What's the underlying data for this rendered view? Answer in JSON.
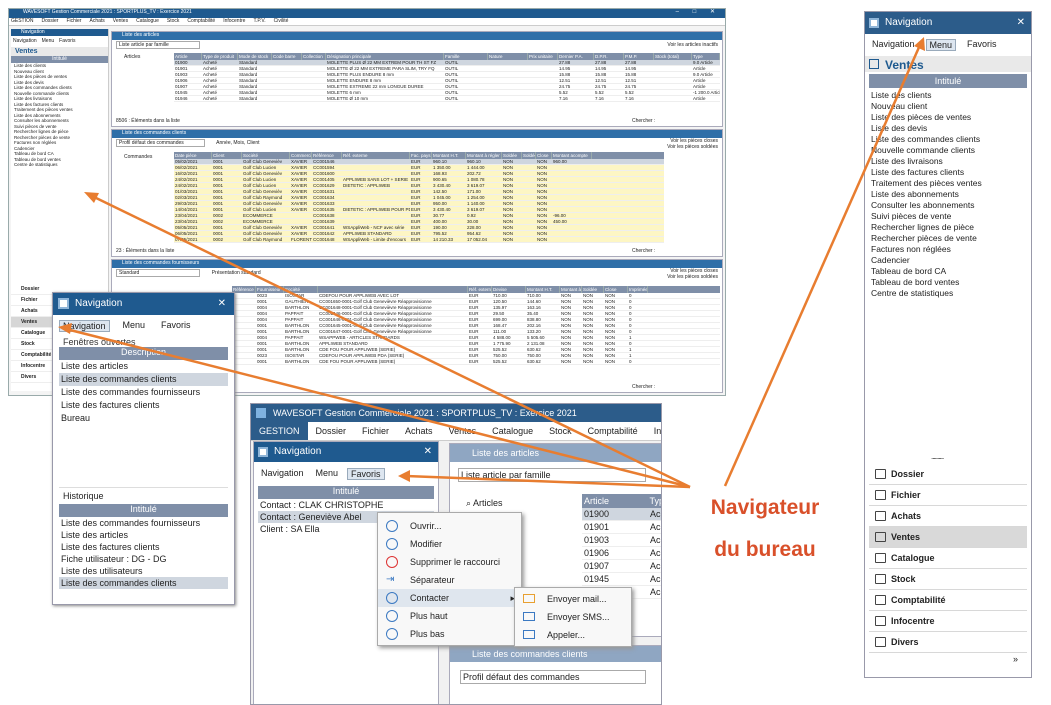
{
  "main_window": {
    "title": "WAVESOFT Gestion Commerciale 2021 : SPORTPLUS_TV : Exercice 2021",
    "menu": [
      "GESTION",
      "Dossier",
      "Fichier",
      "Achats",
      "Ventes",
      "Catalogue",
      "Stock",
      "Comptabilité",
      "Infocentre",
      "T.P.V.",
      "Civilité"
    ]
  },
  "nav_small": {
    "title": "Navigation",
    "tabs": [
      "Navigation",
      "Menu",
      "Favoris"
    ],
    "section": "Ventes",
    "col": "Intitulé",
    "items": [
      "Liste des clients",
      "Nouveau client",
      "Liste des pièces de ventes",
      "Liste des devis",
      "Liste des commandes clients",
      "Nouvelle commande clients",
      "Liste des livraisons",
      "Liste des factures clients",
      "Traitement des pièces ventes",
      "Liste des abonnements",
      "Consulter les abonnements",
      "Suivi pièces de vente",
      "Rechercher lignes de pièce",
      "Rechercher pièces de vente",
      "Factures non réglées",
      "Cadencier",
      "Tableau de bord CA",
      "Tableau de bord ventes",
      "Centre de statistiques"
    ],
    "cats": [
      "Dossier",
      "Fichier",
      "Achats",
      "Ventes",
      "Catalogue",
      "Stock",
      "Comptabilité",
      "Infocentre",
      "Divers"
    ]
  },
  "articles": {
    "title": "Liste des articles",
    "filter": "Liste article par famille",
    "check": "Voir les articles inactifs",
    "tree": "Articles",
    "cols": [
      "Article",
      "Type de produit",
      "Mode de stock",
      "Code barre",
      "Collection",
      "Désignation principale",
      "Famille",
      "Nature",
      "Prix unitaire",
      "Dernier P.A.",
      "D.P.R.",
      "P.M.P.",
      "Stock (total)",
      "Type"
    ],
    "rows": [
      [
        "01900",
        "Acheté",
        "Standard",
        "",
        "",
        "MOLETTE PLUS Ø 22 MM EXTREM POUR TH ST FZ",
        "OUTIL",
        "",
        "",
        "27.88",
        "27.88",
        "27.88",
        "",
        "9.0 Article"
      ],
      [
        "01901",
        "Acheté",
        "Standard",
        "",
        "",
        "MOLETTE Ø 22 MM EXTREME PARA SLIM, TRY FQ",
        "OUTIL",
        "",
        "",
        "14.95",
        "14.95",
        "14.95",
        "",
        "Article"
      ],
      [
        "01903",
        "Acheté",
        "Standard",
        "",
        "",
        "MOLETTE PLUS ENDURE 8 mm",
        "OUTIL",
        "",
        "",
        "15.88",
        "15.88",
        "15.88",
        "",
        "9.0 Article"
      ],
      [
        "01906",
        "Acheté",
        "Standard",
        "",
        "",
        "MOLETTE ENDURE 8 mm",
        "OUTIL",
        "",
        "",
        "12.51",
        "12.51",
        "12.51",
        "",
        "Article"
      ],
      [
        "01907",
        "Acheté",
        "Standard",
        "",
        "",
        "MOLETTE EXTREME 22 mm LONGUE DUREE",
        "OUTIL",
        "",
        "",
        "24.75",
        "24.75",
        "24.75",
        "",
        "Article"
      ],
      [
        "01945",
        "Acheté",
        "Standard",
        "",
        "",
        "MOLETTE 6 mm",
        "OUTIL",
        "",
        "",
        "5.52",
        "5.52",
        "5.52",
        "",
        "-1 200.0 Article"
      ],
      [
        "01946",
        "Acheté",
        "Standard",
        "",
        "",
        "MOLETTE Ø 10 mm",
        "OUTIL",
        "",
        "",
        "7.16",
        "7.16",
        "7.16",
        "",
        "Article"
      ]
    ],
    "count": "8506 : Éléments dans la liste",
    "search": "Chercher :"
  },
  "orders": {
    "title": "Liste des commandes clients",
    "filter": "Profil défaut des commandes",
    "sort": "Année, Mois, Client",
    "tree": "Commandes",
    "checks": [
      "Voir les pièces closes",
      "Voir les pièces soldées"
    ],
    "cols": [
      "Date pièce",
      "Client",
      "Société",
      "Commercial",
      "Référence",
      "Réf. externe",
      "Fac. pays",
      "Montant H.T.",
      "Montant à régler",
      "Soldée",
      "Soldée",
      "Close",
      "Montant acompte"
    ],
    "rows": [
      [
        "05/02/2021",
        "0001",
        "Golf Club Genevièv",
        "XAVIER",
        "CC001546",
        "",
        "EUR",
        "960.10",
        "960.10",
        "NON",
        "",
        "NON",
        "960.00"
      ],
      [
        "06/02/2021",
        "0001",
        "Golf Club Lucien",
        "XAVIER",
        "CC001594",
        "",
        "EUR",
        "1 350.00",
        "1 444.00",
        "NON",
        "",
        "NON",
        ""
      ],
      [
        "16/02/2021",
        "0001",
        "Golf Club Genevièv",
        "XAVIER",
        "CC001600",
        "",
        "EUR",
        "168.93",
        "202.72",
        "NON",
        "",
        "NON",
        ""
      ],
      [
        "24/02/2021",
        "0001",
        "Golf Club Lucien",
        "XAVIER",
        "CC001405",
        "APPLIWEB SANS LOT + SERIE",
        "EUR",
        "900.65",
        "1 080.78",
        "NON",
        "",
        "NON",
        ""
      ],
      [
        "24/02/2021",
        "0001",
        "Golf Club Lucien",
        "XAVIER",
        "CC001629",
        "DIETETIC : APPLIWEB",
        "EUR",
        "3 430.40",
        "3 619.07",
        "NON",
        "",
        "NON",
        ""
      ],
      [
        "01/03/2021",
        "0001",
        "Golf Club Genevièv",
        "XAVIER",
        "CC001631",
        "",
        "EUR",
        "142.50",
        "171.00",
        "NON",
        "",
        "NON",
        ""
      ],
      [
        "02/03/2021",
        "0001",
        "Golf Club Raymond",
        "XAVIER",
        "CC001634",
        "",
        "EUR",
        "1 045.00",
        "1 254.00",
        "NON",
        "",
        "NON",
        ""
      ],
      [
        "29/03/2021",
        "0001",
        "Golf Club Genevièv",
        "XAVIER",
        "CC001633",
        "",
        "EUR",
        "950.00",
        "1 140.00",
        "NON",
        "",
        "NON",
        ""
      ],
      [
        "14/04/2021",
        "0001",
        "Golf Club Lucien",
        "XAVIER",
        "CC001635",
        "DIETETIC : APPLIWEB POUR PDA",
        "EUR",
        "3 430.40",
        "3 619.07",
        "NON",
        "",
        "NON",
        ""
      ],
      [
        "23/04/2021",
        "0002",
        "ECOMMERCE",
        "",
        "CC001638",
        "",
        "EUR",
        "30.77",
        "0.92",
        "NON",
        "",
        "NON",
        "-96.00"
      ],
      [
        "23/04/2021",
        "0002",
        "ECOMMERCE",
        "",
        "CC001639",
        "",
        "EUR",
        "400.00",
        "30.00",
        "NON",
        "",
        "NON",
        "450.00"
      ],
      [
        "05/05/2021",
        "0001",
        "Golf Club Genevièv",
        "XAVIER",
        "CC001641",
        "WSAppliWeb - NCF avec série",
        "EUR",
        "190.00",
        "228.00",
        "NON",
        "",
        "NON",
        ""
      ],
      [
        "06/05/2021",
        "0001",
        "Golf Club Genevièv",
        "XAVIER",
        "CC001642",
        "APPLIWEB STANDARD",
        "EUR",
        "795.52",
        "954.62",
        "NON",
        "",
        "NON",
        ""
      ],
      [
        "07/05/2021",
        "0002",
        "Golf Club Raymond",
        "FLORENT",
        "CC001648",
        "WSAppliWeb - Limite d'encours",
        "EUR",
        "14 210.33",
        "17 052.04",
        "NON",
        "",
        "NON",
        ""
      ]
    ],
    "count": "23 : Éléments dans la liste",
    "search": "Chercher :"
  },
  "suppliers": {
    "title": "Liste des commandes fournisseurs",
    "filter": "Standard",
    "pres": "Présentation standard",
    "checks": [
      "Voir les pièces closes",
      "Voir les pièces soldées"
    ],
    "tree": "Commandes",
    "cols": [
      "Référence",
      "Fournisseur",
      "Société",
      "",
      "Réf. externe",
      "Devise",
      "Montant H.T.",
      "Montant à régl",
      "Soldée",
      "Close",
      "Imprimée",
      "Imprimée",
      "Date impression",
      "Montant acompt",
      "Dev. reset"
    ],
    "rows": [
      [
        "",
        "0023",
        "ISOSTAR",
        "CDEFOU POUR APPLIWEB AVEC LOT",
        "EUR",
        "710.00",
        "710.00",
        "NON",
        "NON",
        "NON",
        "0"
      ],
      [
        "",
        "0001",
        "GAUTHIER",
        "CC001650-0001-Golf Club Genevièvre  Réapprovisionne",
        "EUR",
        "120.50",
        "144.60",
        "NON",
        "NON",
        "NON",
        "0"
      ],
      [
        "",
        "0004",
        "BARTHLON",
        "CC001648-0001-Golf Club Genevièvre  Réapprovisionne",
        "EUR",
        "135.97",
        "163.16",
        "NON",
        "NON",
        "NON",
        "0"
      ],
      [
        "",
        "0004",
        "PAPPAIT",
        "CC001646-0001-Golf Club Genevièvre  Réapprovisionne",
        "EUR",
        "29.50",
        "35.40",
        "NON",
        "NON",
        "NON",
        "0"
      ],
      [
        "",
        "0004",
        "PAPPAIT",
        "CC001646-0001-Golf Club Genevièvre  Réapprovisionne",
        "EUR",
        "699.00",
        "838.80",
        "NON",
        "NON",
        "NON",
        "0"
      ],
      [
        "",
        "0001",
        "BARTHLON",
        "CC001645-0001-Golf Club Genevièvre  Réapprovisionne",
        "EUR",
        "168.47",
        "202.16",
        "NON",
        "NON",
        "NON",
        "0"
      ],
      [
        "",
        "0001",
        "BARTHLON",
        "CC001647-0001-Golf Club Genevièvre  Réapprovisionne",
        "EUR",
        "111.00",
        "133.20",
        "NON",
        "NON",
        "NON",
        "0"
      ],
      [
        "",
        "0004",
        "PAPPAIT",
        "WSAPPWEB - ARTICLES STANDARDS",
        "EUR",
        "4 588.00",
        "5 505.60",
        "NON",
        "NON",
        "NON",
        "1"
      ],
      [
        "",
        "0001",
        "BARTHLON",
        "APPLIWEB STANDARD",
        "EUR",
        "1 775.90",
        "2 131.08",
        "NON",
        "NON",
        "NON",
        "0"
      ],
      [
        "",
        "0001",
        "BARTHLON",
        "CDE FOU POUR APPLIWEB (SERIE)",
        "EUR",
        "525.52",
        "630.62",
        "NON",
        "NON",
        "NON",
        "1"
      ],
      [
        "",
        "0023",
        "ISOSTAR",
        "CDEFOU POUR APPLIWEB PDA (SERIE)",
        "EUR",
        "750.00",
        "750.00",
        "NON",
        "NON",
        "NON",
        "1"
      ],
      [
        "",
        "0001",
        "BARTHLON",
        "CDE FOU POUR APPLIWEB (SERIE)",
        "EUR",
        "525.52",
        "630.62",
        "NON",
        "NON",
        "NON",
        "0"
      ]
    ],
    "search": "Chercher :"
  },
  "nav_mid": {
    "title": "Navigation",
    "tabs": [
      "Navigation",
      "Menu",
      "Favoris"
    ],
    "open_label": "Fenêtres ouvertes",
    "col": "Description",
    "open": [
      "Liste des articles",
      "Liste des commandes clients",
      "Liste des commandes fournisseurs",
      "Liste des factures clients",
      "Bureau"
    ],
    "hist_label": "Historique",
    "hist_col": "Intitulé",
    "hist": [
      "Liste des commandes fournisseurs",
      "Liste des articles",
      "Liste des factures clients",
      "Fiche utilisateur : DG - DG",
      "Liste des utilisateurs",
      "Liste des commandes clients"
    ]
  },
  "zoom": {
    "title": "WAVESOFT Gestion Commerciale 2021 : SPORTPLUS_TV : Exercice 2021",
    "menu": [
      "GESTION",
      "Dossier",
      "Fichier",
      "Achats",
      "Ventes",
      "Catalogue",
      "Stock",
      "Comptabilité",
      "Infocent"
    ],
    "nav_title": "Navigation",
    "tabs": [
      "Navigation",
      "Menu",
      "Favoris"
    ],
    "col": "Intitulé",
    "favs": [
      "Contact : CLAK CHRISTOPHE",
      "Contact : Geneviève Abel",
      "Client : SA Ella"
    ],
    "ctx": [
      "Ouvrir...",
      "Modifier",
      "Supprimer le raccourci",
      "Séparateur",
      "Contacter",
      "Plus haut",
      "Plus bas"
    ],
    "sub": [
      "Envoyer mail...",
      "Envoyer SMS...",
      "Appeler..."
    ],
    "art_title": "Liste des articles",
    "art_filter": "Liste article par famille",
    "art_tree": "Articles",
    "art_col1": "Article",
    "art_col2": "Typ",
    "art_rows": [
      "01900",
      "01901",
      "01903",
      "01906",
      "01907",
      "01945",
      "01946"
    ],
    "art_type": "Acl",
    "ord_title": "Liste des commandes clients",
    "ord_filter": "Profil défaut des commandes"
  },
  "nav_big": {
    "title": "Navigation",
    "tabs": [
      "Navigation",
      "Menu",
      "Favoris"
    ],
    "section": "Ventes",
    "col": "Intitulé",
    "items": [
      "Liste des clients",
      "Nouveau client",
      "Liste des pièces de ventes",
      "Liste des devis",
      "Liste des commandes clients",
      "Nouvelle commande clients",
      "Liste des livraisons",
      "Liste des factures clients",
      "Traitement des pièces ventes",
      "Liste des abonnements",
      "Consulter les abonnements",
      "Suivi pièces de vente",
      "Rechercher lignes de pièce",
      "Rechercher pièces de vente",
      "Factures non réglées",
      "Cadencier",
      "Tableau de bord CA",
      "Tableau de bord ventes",
      "Centre de statistiques"
    ],
    "dots": "..........",
    "cats": [
      "Dossier",
      "Fichier",
      "Achats",
      "Ventes",
      "Catalogue",
      "Stock",
      "Comptabilité",
      "Infocentre",
      "Divers"
    ]
  },
  "callout": {
    "line1": "Navigateur",
    "line2": "du bureau"
  },
  "colors": {
    "accent": "#e87d30",
    "titlebar": "#1f5a8f",
    "header": "#7f8fa8",
    "highlight": "#fdf6c4"
  }
}
